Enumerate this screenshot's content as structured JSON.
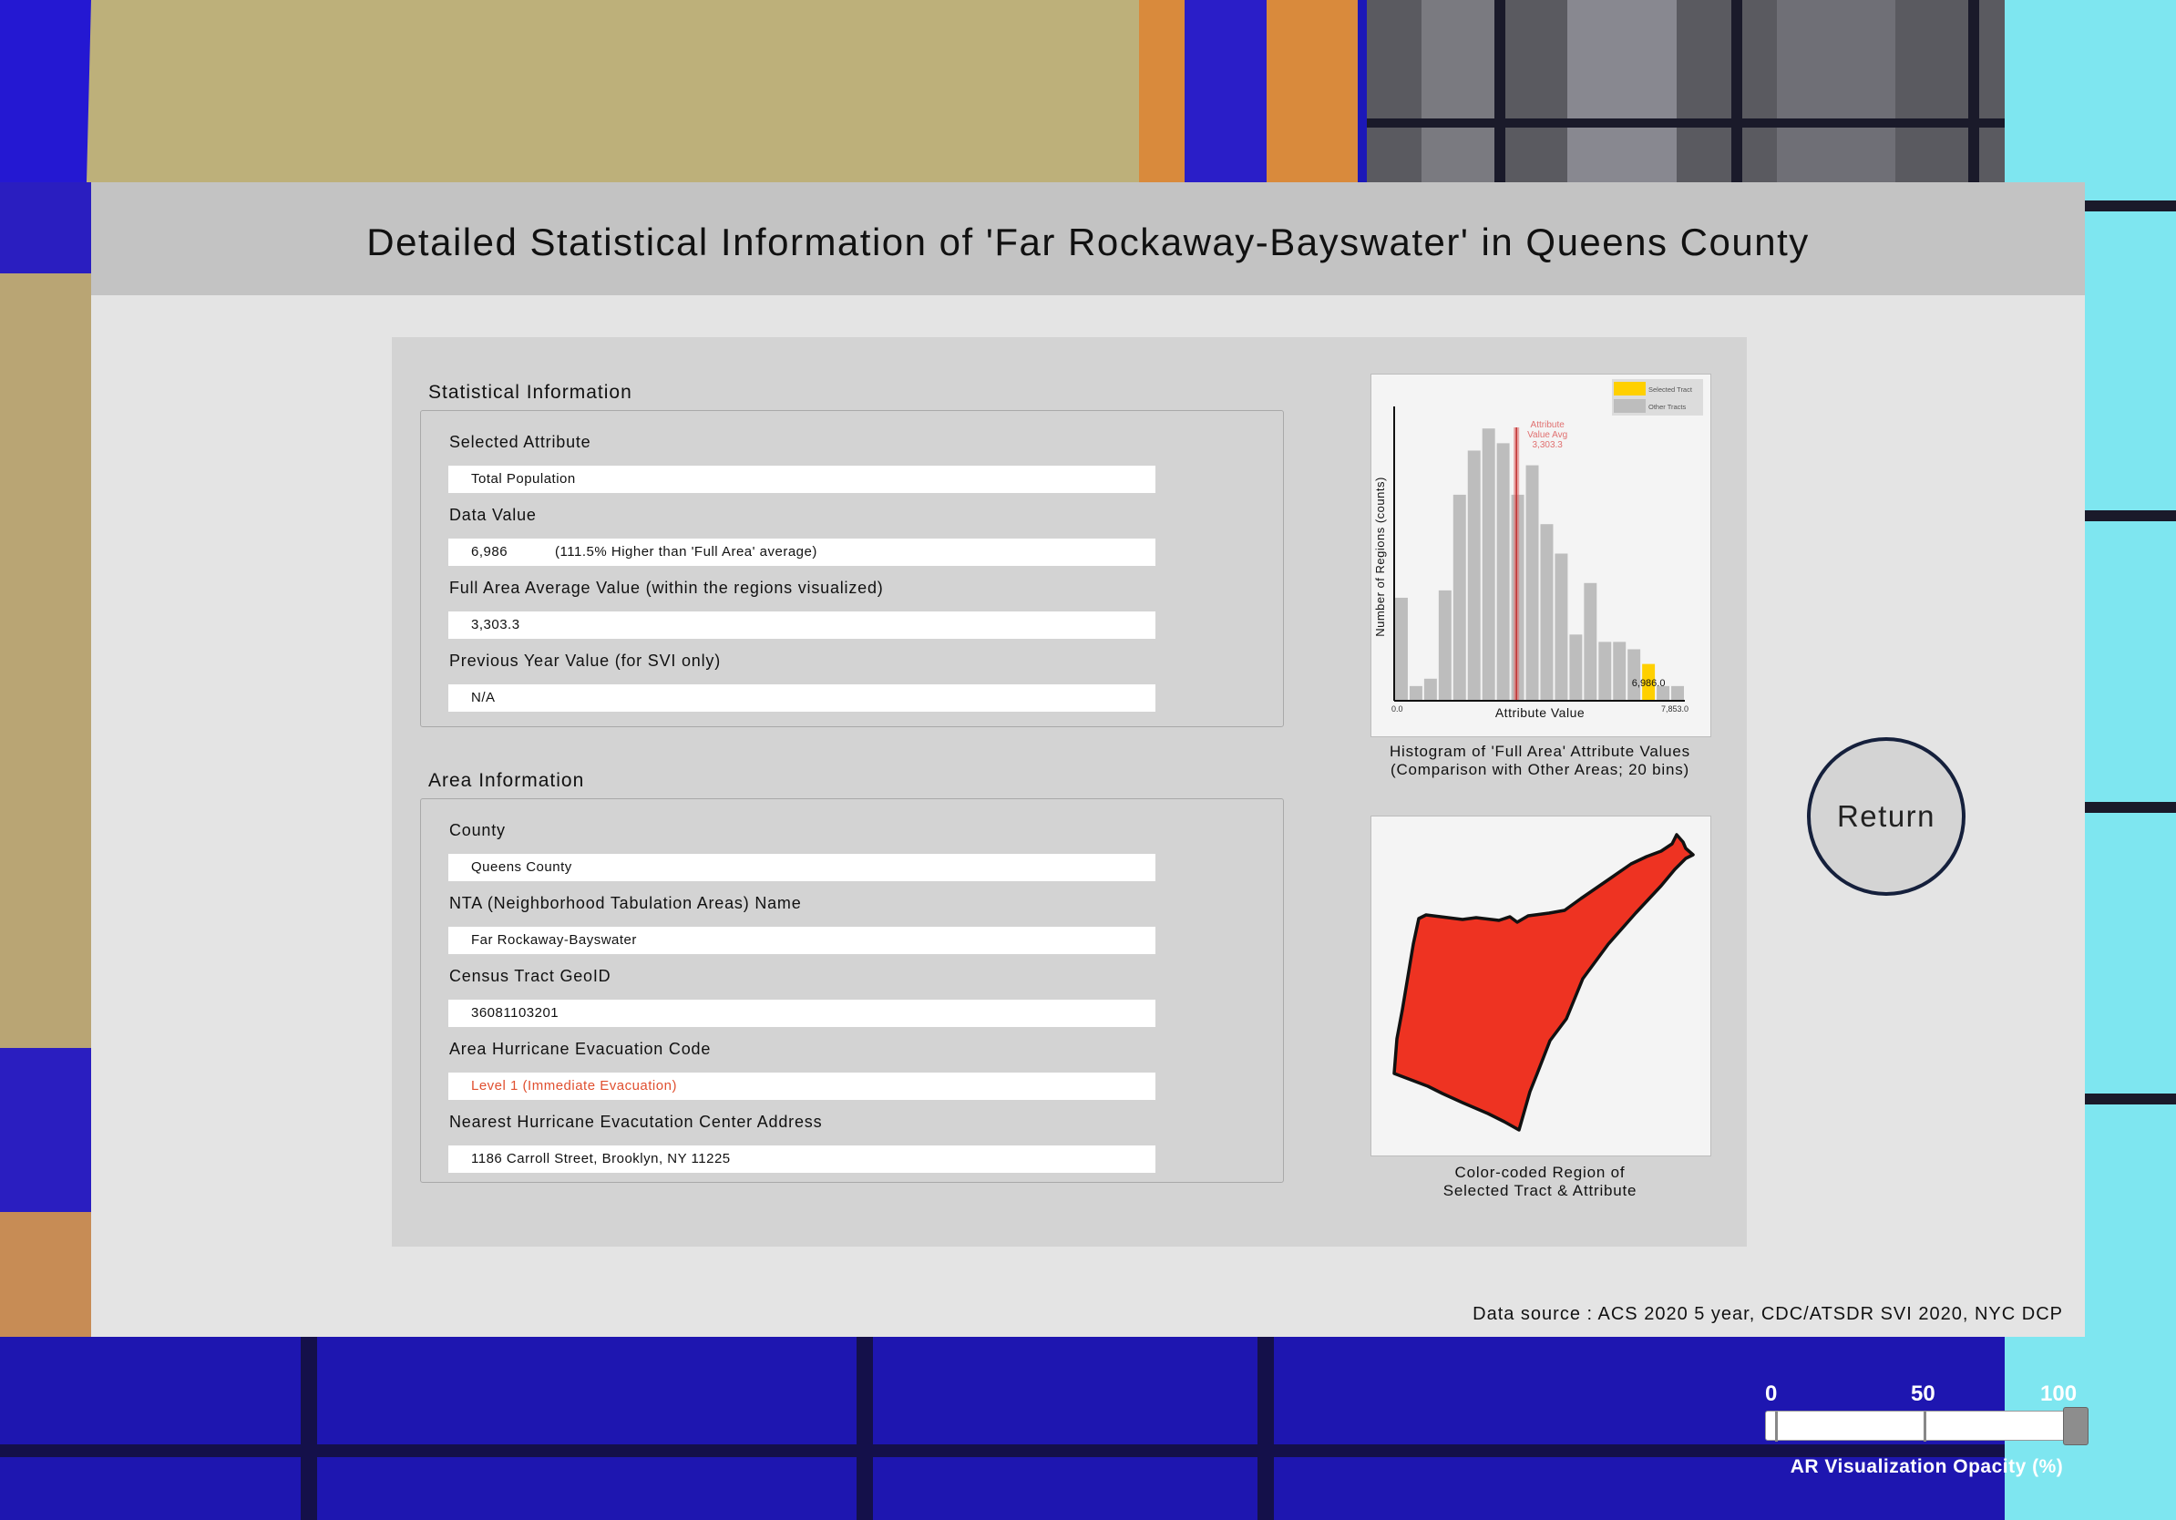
{
  "title": "Detailed Statistical Information of 'Far Rockaway-Bayswater' in Queens County",
  "statistical": {
    "heading": "Statistical Information",
    "selected_attribute_label": "Selected Attribute",
    "selected_attribute_value": "Total Population",
    "data_value_label": "Data Value",
    "data_value": "6,986",
    "data_value_note": "(111.5% Higher than 'Full Area' average)",
    "full_avg_label": "Full Area Average Value (within the regions visualized)",
    "full_avg_value": "3,303.3",
    "prev_year_label": "Previous Year Value (for SVI only)",
    "prev_year_value": "N/A"
  },
  "area": {
    "heading": "Area Information",
    "county_label": "County",
    "county_value": "Queens County",
    "nta_label": "NTA (Neighborhood Tabulation Areas) Name",
    "nta_value": "Far Rockaway-Bayswater",
    "geoid_label": "Census Tract GeoID",
    "geoid_value": "36081103201",
    "evac_code_label": "Area Hurricane Evacuation Code",
    "evac_code_value": "Level 1 (Immediate Evacuation)",
    "evac_center_label": "Nearest Hurricane Evacutation Center Address",
    "evac_center_value": "1186 Carroll Street, Brooklyn, NY 11225"
  },
  "chart_data": {
    "type": "bar",
    "xlabel": "Attribute Value",
    "ylabel": "Number of Regions (counts)",
    "x_min_label": "0.0",
    "x_max_label": "7,853.0",
    "xlim": [
      0,
      7853
    ],
    "bins": 20,
    "values": [
      7,
      1,
      1.5,
      7.5,
      14,
      17,
      18.5,
      17.5,
      14,
      16,
      12,
      10,
      4.5,
      8,
      4,
      4,
      3.5,
      2.5,
      1,
      1
    ],
    "highlight_bin": 17,
    "avg_value": 3303.3,
    "avg_annotation": [
      "Attribute",
      "Value Avg",
      "3,303.3"
    ],
    "selected_value_label": "6,986.0",
    "legend": [
      "Selected Tract",
      "Other Tracts"
    ],
    "legend_position": "top-right",
    "colors": {
      "selected": "#ffd000",
      "other": "#bdbdbd",
      "avg": "#e07070"
    }
  },
  "histogram_caption_1": "Histogram of 'Full Area' Attribute Values",
  "histogram_caption_2": "(Comparison with Other Areas; 20 bins)",
  "region_caption_1": "Color-coded Region of",
  "region_caption_2": "Selected Tract & Attribute",
  "region_color": "#ee3322",
  "return_label": "Return",
  "data_source": "Data source : ACS 2020 5 year, CDC/ATSDR SVI 2020, NYC DCP",
  "opacity": {
    "tick_0": "0",
    "tick_50": "50",
    "tick_100": "100",
    "value_percent": 100,
    "label": "AR Visualization Opacity (%)"
  }
}
